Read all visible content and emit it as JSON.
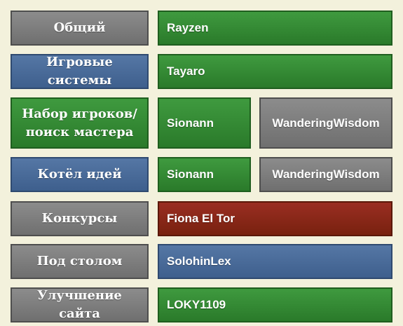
{
  "rows": [
    {
      "forum": {
        "label": "Общий",
        "color": "#777777"
      },
      "moderators": [
        {
          "name": "Rayzen",
          "color": "#2f8a2f"
        }
      ]
    },
    {
      "forum": {
        "label": "Игровые системы",
        "color": "#476a99"
      },
      "moderators": [
        {
          "name": "Tayaro",
          "color": "#2f8a2f"
        }
      ]
    },
    {
      "forum": {
        "label_line1": "Набор игроков/",
        "label_line2": "поиск мастера",
        "color": "#2f8a2f"
      },
      "moderators": [
        {
          "name": "Sionann",
          "color": "#2f8a2f"
        },
        {
          "name": "WanderingWisdom",
          "color": "#777777"
        }
      ]
    },
    {
      "forum": {
        "label": "Котёл идей",
        "color": "#476a99"
      },
      "moderators": [
        {
          "name": "Sionann",
          "color": "#2f8a2f"
        },
        {
          "name": "WanderingWisdom",
          "color": "#777777"
        }
      ]
    },
    {
      "forum": {
        "label": "Конкурсы",
        "color": "#777777"
      },
      "moderators": [
        {
          "name": "Fiona El Tor",
          "color": "#862818"
        }
      ]
    },
    {
      "forum": {
        "label": "Под столом",
        "color": "#777777"
      },
      "moderators": [
        {
          "name": "SolohinLex",
          "color": "#476a99"
        }
      ]
    },
    {
      "forum": {
        "label": "Улучшение сайта",
        "color": "#777777"
      },
      "moderators": [
        {
          "name": "LOKY1109",
          "color": "#2f8a2f"
        }
      ]
    }
  ]
}
